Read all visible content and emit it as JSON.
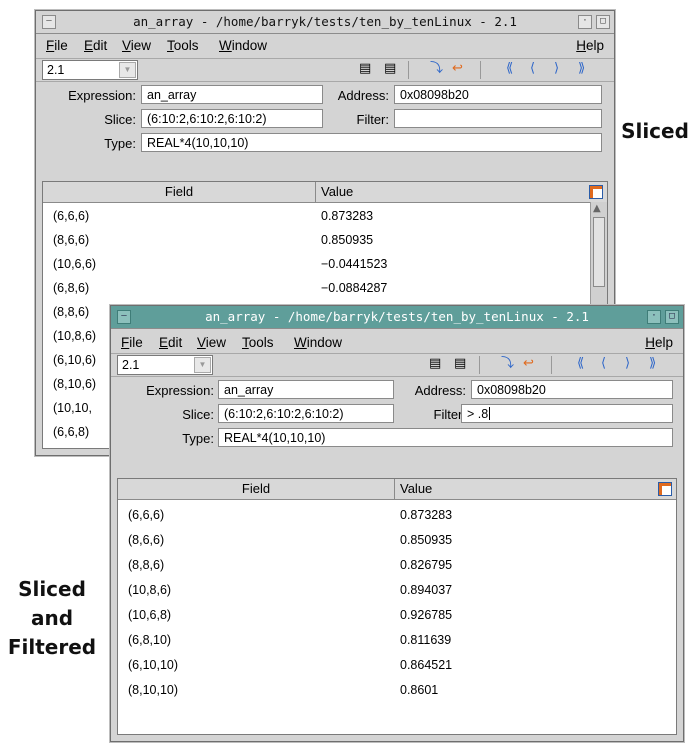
{
  "colors": {
    "title_active": "#5f9e9a",
    "chrome": "#d4d4d4",
    "accent_orange": "#e06a1e",
    "accent_blue": "#2f67c9"
  },
  "annotations": {
    "sliced": "Sliced",
    "sliced_filtered": [
      "Sliced",
      "and",
      "Filtered"
    ]
  },
  "back_window": {
    "title": "an_array - /home/barryk/tests/ten_by_tenLinux - 2.1",
    "menu": [
      "File",
      "Edit",
      "View",
      "Tools",
      "Window"
    ],
    "help": "Help",
    "combo_value": "2.1",
    "expression_label": "Expression:",
    "expression_value": "an_array",
    "address_label": "Address:",
    "address_value": "0x08098b20",
    "slice_label": "Slice:",
    "slice_value": "(6:10:2,6:10:2,6:10:2)",
    "filter_label": "Filter:",
    "filter_value": "",
    "type_label": "Type:",
    "type_value": "REAL*4(10,10,10)",
    "columns": [
      "Field",
      "Value"
    ],
    "rows": [
      {
        "field": "(6,6,6)",
        "value": "0.873283"
      },
      {
        "field": "(8,6,6)",
        "value": "0.850935"
      },
      {
        "field": "(10,6,6)",
        "value": "−0.0441523"
      },
      {
        "field": "(6,8,6)",
        "value": "−0.0884287"
      },
      {
        "field": "(8,8,6)",
        "value": ""
      },
      {
        "field": "(10,8,6)",
        "value": ""
      },
      {
        "field": "(6,10,6)",
        "value": ""
      },
      {
        "field": "(8,10,6)",
        "value": ""
      },
      {
        "field": "(10,10,",
        "value": ""
      },
      {
        "field": "(6,6,8)",
        "value": ""
      }
    ]
  },
  "front_window": {
    "title": "an_array - /home/barryk/tests/ten_by_tenLinux - 2.1",
    "menu": [
      "File",
      "Edit",
      "View",
      "Tools",
      "Window"
    ],
    "help": "Help",
    "combo_value": "2.1",
    "expression_label": "Expression:",
    "expression_value": "an_array",
    "address_label": "Address:",
    "address_value": "0x08098b20",
    "slice_label": "Slice:",
    "slice_value": "(6:10:2,6:10:2,6:10:2)",
    "filter_label": "Filter:",
    "filter_value": "> .8",
    "type_label": "Type:",
    "type_value": "REAL*4(10,10,10)",
    "columns": [
      "Field",
      "Value"
    ],
    "rows": [
      {
        "field": "(6,6,6)",
        "value": "0.873283"
      },
      {
        "field": "(8,6,6)",
        "value": "0.850935"
      },
      {
        "field": "(8,8,6)",
        "value": "0.826795"
      },
      {
        "field": "(10,8,6)",
        "value": "0.894037"
      },
      {
        "field": "(10,6,8)",
        "value": "0.926785"
      },
      {
        "field": "(6,8,10)",
        "value": "0.811639"
      },
      {
        "field": "(6,10,10)",
        "value": "0.864521"
      },
      {
        "field": "(8,10,10)",
        "value": "0.8601"
      }
    ]
  }
}
